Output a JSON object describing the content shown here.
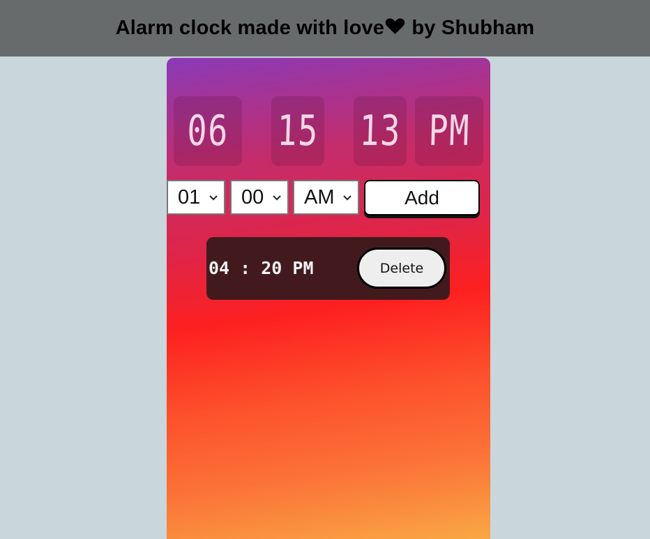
{
  "header": {
    "title_prefix": "Alarm clock made with love",
    "title_suffix": " by Shubham"
  },
  "clock": {
    "hours": "06",
    "minutes": "15",
    "seconds": "13",
    "ampm": "PM"
  },
  "controls": {
    "hour_select": "01",
    "minute_select": "00",
    "ampm_select": "AM",
    "add_label": "Add"
  },
  "alarms": [
    {
      "time": "04 : 20 PM",
      "delete_label": "Delete"
    }
  ],
  "colors": {
    "header_bg": "#686b6c",
    "page_bg": "#c9d6db",
    "alarm_bg": "#421a1e",
    "heart": "#000000"
  },
  "icons": {
    "heart": "heart-icon",
    "dropdown": "chevron-down-icon"
  }
}
